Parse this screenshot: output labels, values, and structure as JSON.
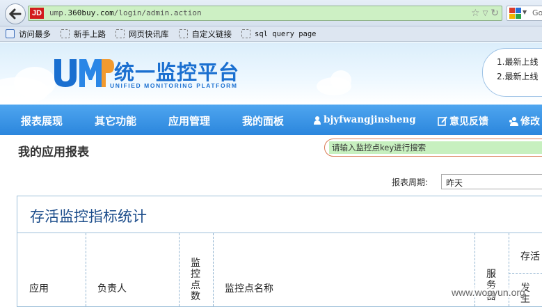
{
  "browser": {
    "favicon_text": "JD",
    "url_prefix": "ump.",
    "url_domain": "360buy.com",
    "url_path": "/login/admin.action",
    "search_engine_text": "Go",
    "bookmarks": [
      "访问最多",
      "新手上路",
      "网页快讯库",
      "自定义链接",
      "sql query page"
    ]
  },
  "header": {
    "logo_title": "统一监控平台",
    "logo_subtitle": "UNIFIED MONITORING PLATFORM",
    "notices": [
      "1.最新上线",
      "2.最新上线"
    ]
  },
  "nav": {
    "items": [
      "报表展现",
      "其它功能",
      "应用管理",
      "我的面板"
    ],
    "user": "bjyfwangjinsheng",
    "feedback": "意见反馈",
    "edit": "修改"
  },
  "content": {
    "page_title": "我的应用报表",
    "search_placeholder": "请输入监控点key进行搜索",
    "period_label": "报表周期:",
    "period_value": "昨天",
    "panel_title": "存活监控指标统计",
    "columns": {
      "app": "应用",
      "owner": "负责人",
      "points": "监控点数",
      "point_name": "监控点名称",
      "server": "服务器",
      "alive": "存活",
      "alive_sub": "发生"
    }
  },
  "watermark": "www.wooyun.org",
  "colors": {
    "nav": "#2b86dd",
    "accent": "#1a6fd0",
    "url_bg": "#cdf0c4"
  }
}
